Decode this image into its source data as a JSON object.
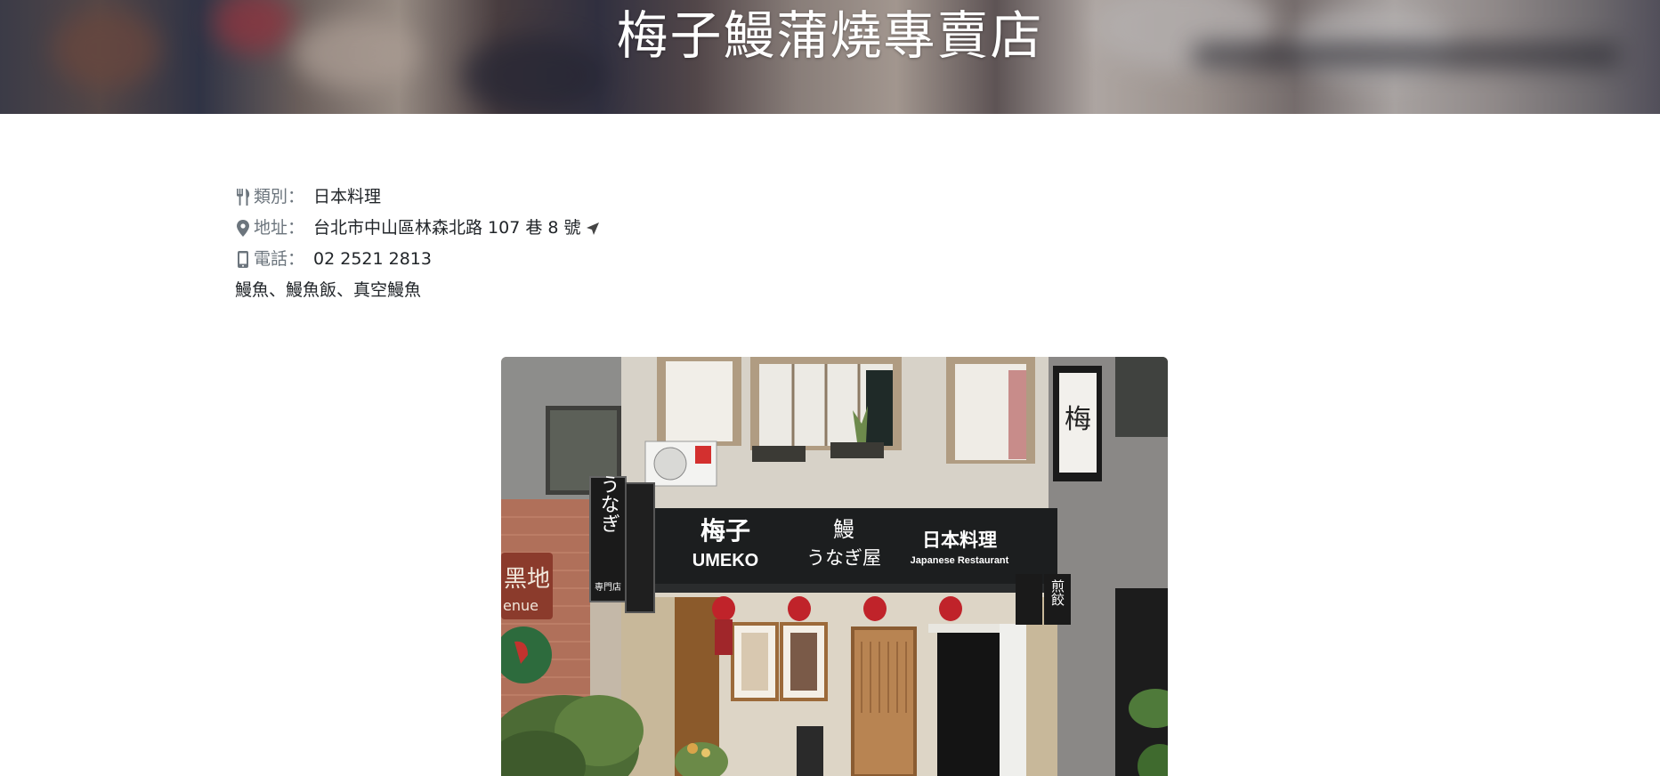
{
  "header": {
    "title": "梅子鰻蒲燒專賣店"
  },
  "info": {
    "category": {
      "icon": "utensils-icon",
      "label": "類別：",
      "value": "日本料理"
    },
    "address": {
      "icon": "map-marker-icon",
      "label": "地址：",
      "value": "台北市中山區林森北路 107 巷 8 號",
      "nav_icon": "location-arrow-icon"
    },
    "phone": {
      "icon": "mobile-phone-icon",
      "label": "電話：",
      "value": "02 2521 2813"
    },
    "tags": "鰻魚、鰻魚飯、真空鰻魚"
  },
  "photo": {
    "sign_shop_name": "梅子",
    "sign_romaji": "UMEKO",
    "sign_eel": "鰻",
    "sign_eel_kana": "うなぎ屋",
    "sign_japanese": "日本料理",
    "sign_english": "Japanese Restaurant",
    "vertical_sign": "うなぎ",
    "vertical_sign_small": "専門店",
    "right_sign": "煎餃",
    "left_wall_sign": "黑地",
    "left_wall_sign_sub": "enue"
  },
  "colors": {
    "label_gray": "#6c757d",
    "text": "#212529",
    "awning": "#1c1e1f"
  }
}
